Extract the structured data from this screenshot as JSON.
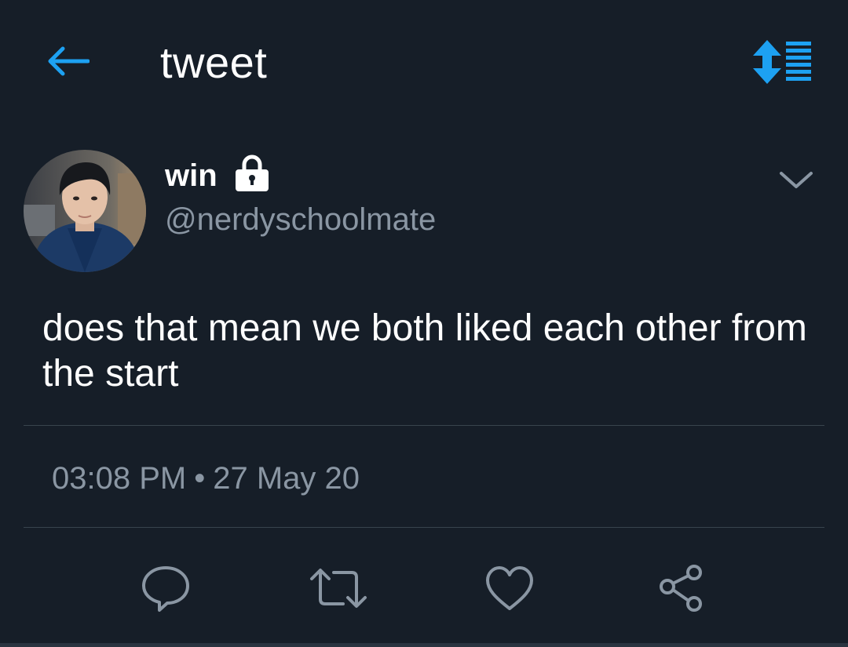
{
  "header": {
    "title": "tweet",
    "back_icon": "arrow-left-icon",
    "sort_icon": "sort-order-icon"
  },
  "tweet": {
    "author": {
      "name": "win",
      "handle": "@nerdyschoolmate",
      "protected": true,
      "lock_icon": "lock-icon"
    },
    "text": "does that mean we both liked each other from the start",
    "time": "03:08 PM",
    "separator": "•",
    "date": "27 May 20"
  },
  "actions": [
    {
      "icon": "reply-icon"
    },
    {
      "icon": "retweet-icon"
    },
    {
      "icon": "like-icon"
    },
    {
      "icon": "share-icon"
    }
  ],
  "colors": {
    "background": "#161e28",
    "accent": "#1da1f2",
    "secondary_text": "#8a96a3",
    "icon_gray": "#8a96a3",
    "divider": "#38444d"
  }
}
